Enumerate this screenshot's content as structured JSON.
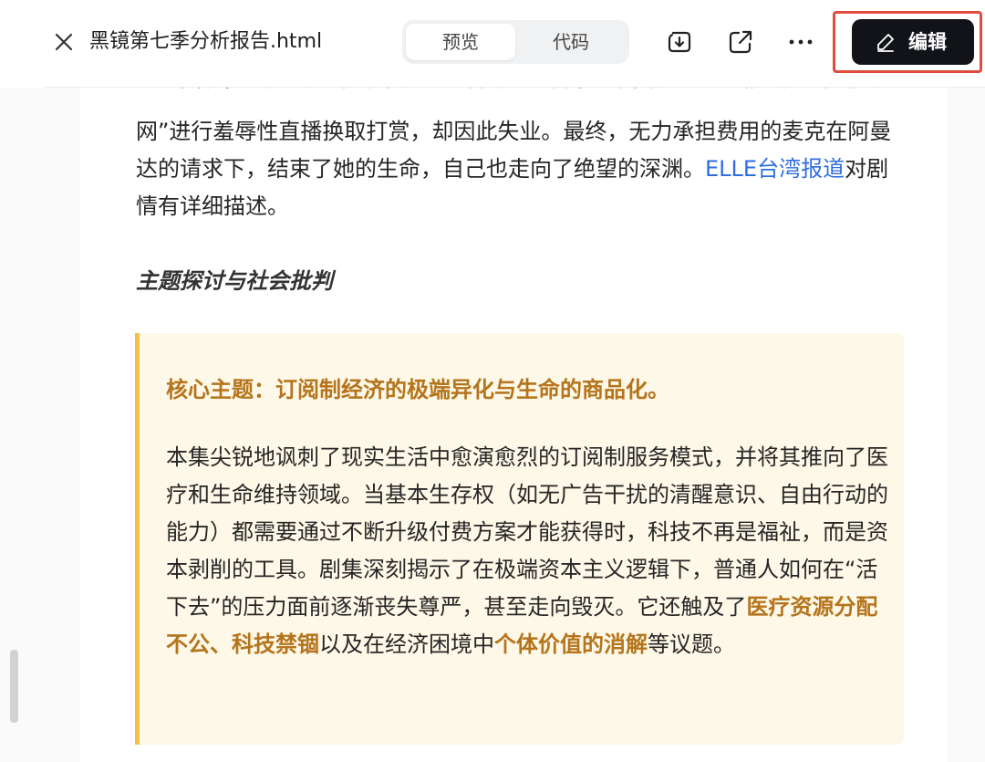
{
  "header": {
    "file_title": "黑镜第七季分析报告.html",
    "tabs": [
      {
        "label": "预览",
        "active": true
      },
      {
        "label": "代码",
        "active": false
      }
    ],
    "edit_label": "编辑",
    "icons": [
      "close-icon",
      "download-icon",
      "share-icon",
      "more-icon",
      "edit-pencil-icon"
    ]
  },
  "document": {
    "partial_top_line": "经济困境，丈夫麦克不得不在一个名为“羞辱网”的网站上通过出卖尊严来赚钱",
    "paragraph": {
      "text": "网”进行羞辱性直播换取打赏，却因此失业。最终，无力承担费用的麦克在阿曼达的请求下，结束了她的生命，自己也走向了绝望的深渊。",
      "link": "ELLE台湾报道",
      "after_link": "对剧情有详细描述。"
    },
    "subheading": "主题探讨与社会批判",
    "callout": {
      "title": "核心主题：订阅制经济的极端异化与生命的商品化。",
      "body_1": "本集尖锐地讽刺了现实生活中愈演愈烈的订阅制服务模式，并将其推向了医疗和生命维持领域。当基本生存权（如无广告干扰的清醒意识、自由行动的能力）都需要通过不断升级付费方案才能获得时，科技不再是福祉，而是资本剥削的工具。剧集深刻揭示了在极端资本主义逻辑下，普通人如何在“活下去”的压力面前逐渐丧失尊严，甚至走向毁灭。它还触及了",
      "highlight_1": "医疗资源分配不公、科技禁锢",
      "body_2": "以及在经济困境中",
      "highlight_2": "个体价值的消解",
      "body_3": "等议题。"
    }
  },
  "colors": {
    "accent_gold": "#b5741c",
    "callout_bg": "#fdf8e7",
    "callout_border": "#f2c042",
    "link": "#2f6de1",
    "edit_button_bg": "#111318",
    "highlight_outline": "#e04b3c"
  }
}
